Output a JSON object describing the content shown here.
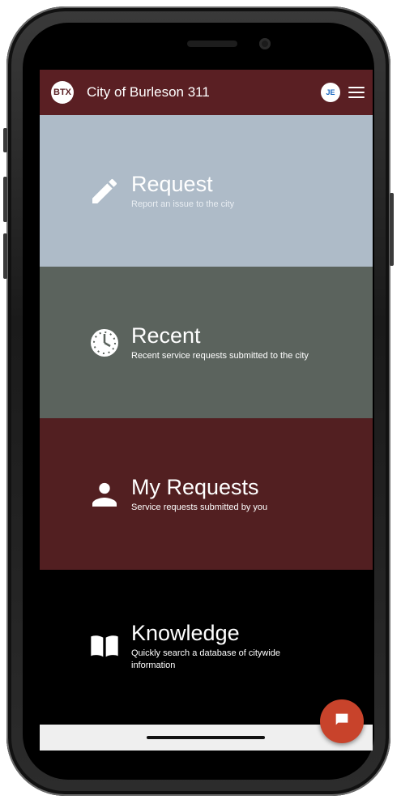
{
  "header": {
    "logo_text": "BTX",
    "title": "City of Burleson 311",
    "avatar_initials": "JE"
  },
  "tiles": [
    {
      "title": "Request",
      "subtitle": "Report an issue to the city",
      "icon": "pencil-icon"
    },
    {
      "title": "Recent",
      "subtitle": "Recent service requests submitted to the city",
      "icon": "clock-icon"
    },
    {
      "title": "My Requests",
      "subtitle": "Service requests submitted by you",
      "icon": "person-icon"
    },
    {
      "title": "Knowledge",
      "subtitle": "Quickly search a database of citywide information",
      "icon": "book-icon"
    }
  ],
  "fab": {
    "icon": "chat-icon"
  },
  "colors": {
    "appbar": "#5a1f23",
    "request": "#aebbc8",
    "recent": "#5b635d",
    "my_requests": "#521f21",
    "knowledge": "#000000",
    "fab": "#c8432b"
  }
}
